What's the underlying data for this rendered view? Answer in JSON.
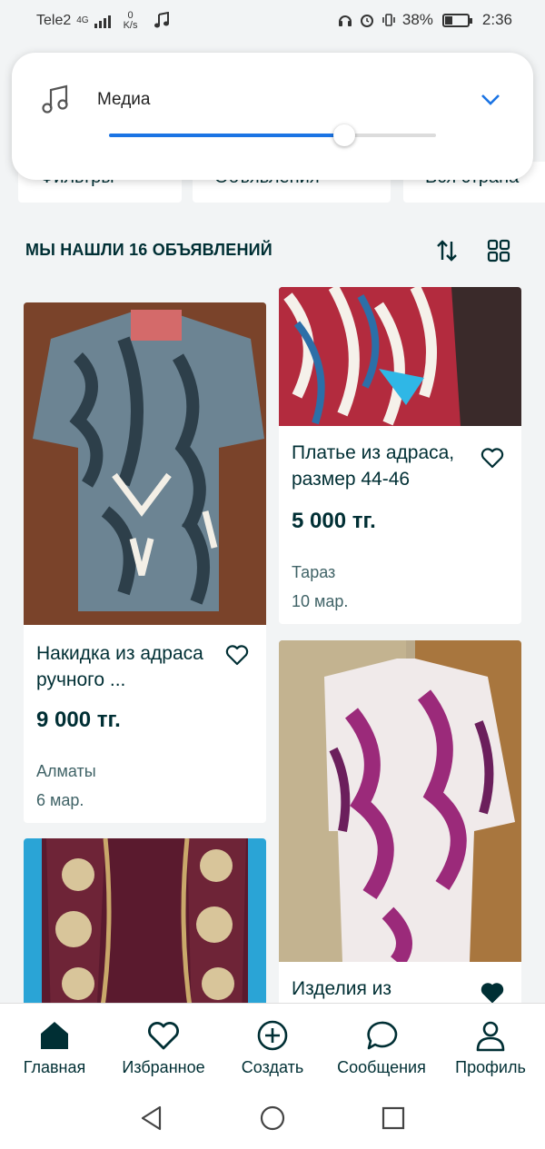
{
  "status_bar": {
    "carrier": "Tele2",
    "network": "4G",
    "speed_value": "0",
    "speed_unit": "K/s",
    "battery": "38%",
    "battery_level": 0.38,
    "time": "2:36"
  },
  "volume_panel": {
    "label": "Медиа",
    "level": 0.72,
    "accent": "#1b74e4"
  },
  "filters": {
    "items": [
      "Фильтры",
      "Объявления",
      "Вся страна"
    ]
  },
  "results": {
    "title": "МЫ НАШЛИ 16 ОБЪЯВЛЕНИЙ"
  },
  "listings": [
    {
      "title": "Накидка из адраса ручного ...",
      "price": "9 000 тг.",
      "city": "Алматы",
      "date": "6 мар.",
      "favorited": false
    },
    {
      "title": "Платье из адраса, размер 44-46",
      "price": "5 000 тг.",
      "city": "Тараз",
      "date": "10 мар.",
      "favorited": false
    },
    {
      "title": "Изделия из",
      "favorited": true
    }
  ],
  "bottom_nav": [
    {
      "label": "Главная",
      "icon": "home-icon",
      "active": true
    },
    {
      "label": "Избранное",
      "icon": "heart-icon"
    },
    {
      "label": "Создать",
      "icon": "plus-circle-icon"
    },
    {
      "label": "Сообщения",
      "icon": "chat-icon"
    },
    {
      "label": "Профиль",
      "icon": "user-icon"
    }
  ],
  "colors": {
    "brand_text": "#002f34",
    "muted_text": "#406367",
    "background": "#f2f4f5"
  }
}
